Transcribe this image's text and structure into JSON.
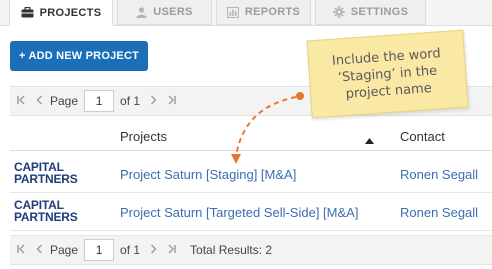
{
  "tabs": [
    {
      "label": "PROJECTS",
      "icon": "briefcase-icon",
      "active": true
    },
    {
      "label": "USERS",
      "icon": "user-icon",
      "active": false
    },
    {
      "label": "REPORTS",
      "icon": "bar-chart-icon",
      "active": false
    },
    {
      "label": "SETTINGS",
      "icon": "gear-icon",
      "active": false
    }
  ],
  "toolbar": {
    "add_label": "+ ADD NEW PROJECT"
  },
  "callout": {
    "lines": [
      "Include the word",
      "‘Staging’ in the",
      "project name"
    ]
  },
  "pager_top": {
    "page_label": "Page",
    "page_value": "1",
    "of_label": "of 1"
  },
  "pager_bottom": {
    "page_label": "Page",
    "page_value": "1",
    "of_label": "of 1",
    "total": "Total Results: 2"
  },
  "table": {
    "headers": {
      "projects": "Projects",
      "contact": "Contact"
    },
    "rows": [
      {
        "company_line1": "CAPITAL",
        "company_line2": "PARTNERS",
        "project": "Project Saturn [Staging] [M&A]",
        "contact": "Ronen Segall"
      },
      {
        "company_line1": "CAPITAL",
        "company_line2": "PARTNERS",
        "project": "Project Saturn [Targeted Sell-Side] [M&A]",
        "contact": "Ronen Segall"
      }
    ]
  },
  "colors": {
    "primary_button": "#1b6fb8",
    "link": "#3a6fb0",
    "callout_bg": "#fae8a5",
    "arrow": "#e8772e",
    "logo": "#1f3d7a"
  }
}
